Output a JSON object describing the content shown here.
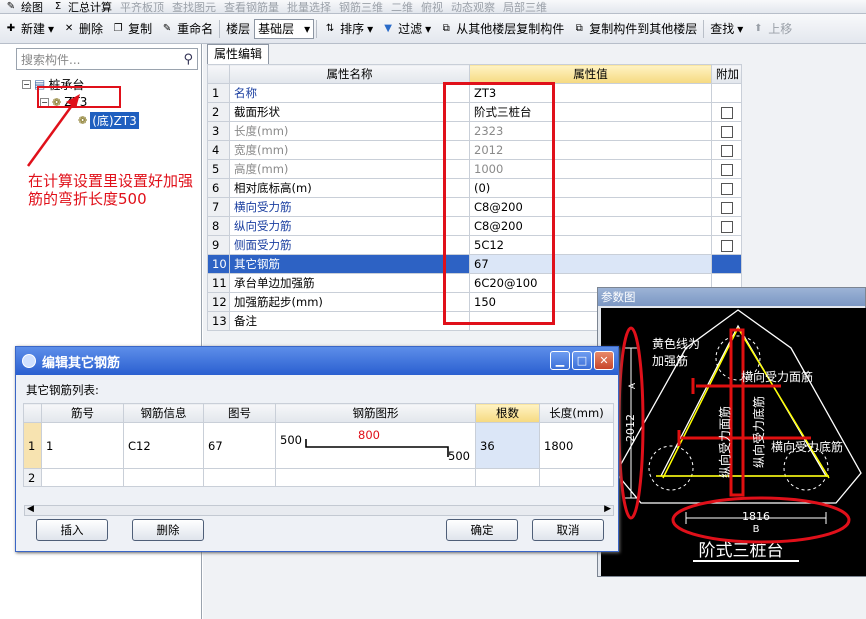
{
  "toolbar1": {
    "items": [
      "绘图",
      "汇总计算",
      "平齐板顶",
      "查找图元",
      "查看钢筋量",
      "批量选择",
      "钢筋三维",
      "二维",
      "俯视",
      "动态观察",
      "局部三维"
    ]
  },
  "toolbar2": {
    "new": "新建",
    "delete": "删除",
    "copy": "复制",
    "rename": "重命名",
    "floor_label": "楼层",
    "floor_value": "基础层",
    "sort": "排序",
    "filter": "过滤",
    "copy_from": "从其他楼层复制构件",
    "copy_to": "复制构件到其他楼层",
    "find": "查找",
    "up": "上移"
  },
  "left": {
    "search_placeholder": "搜索构件...",
    "tree": {
      "root": "桩承台",
      "child": "ZT3",
      "leaf": "(底)ZT3"
    },
    "annotation": "在计算设置里设置好加强筋的弯折长度500"
  },
  "props": {
    "tab": "属性编辑",
    "headers": [
      "属性名称",
      "属性值",
      "附加"
    ],
    "rows": [
      {
        "n": "1",
        "name": "名称",
        "value": "ZT3",
        "style": "blue",
        "cb": false
      },
      {
        "n": "2",
        "name": "截面形状",
        "value": "阶式三桩台",
        "style": "",
        "cb": true
      },
      {
        "n": "3",
        "name": "长度(mm)",
        "value": "2323",
        "style": "gray",
        "cb": true
      },
      {
        "n": "4",
        "name": "宽度(mm)",
        "value": "2012",
        "style": "gray",
        "cb": true
      },
      {
        "n": "5",
        "name": "高度(mm)",
        "value": "1000",
        "style": "gray",
        "cb": true
      },
      {
        "n": "6",
        "name": "相对底标高(m)",
        "value": "(0)",
        "style": "",
        "cb": true
      },
      {
        "n": "7",
        "name": "横向受力筋",
        "value": "C8@200",
        "style": "blue",
        "cb": true
      },
      {
        "n": "8",
        "name": "纵向受力筋",
        "value": "C8@200",
        "style": "blue",
        "cb": true
      },
      {
        "n": "9",
        "name": "侧面受力筋",
        "value": "5C12",
        "style": "blue",
        "cb": true
      },
      {
        "n": "10",
        "name": "其它钢筋",
        "value": "67",
        "style": "sel",
        "cb": false
      },
      {
        "n": "11",
        "name": "承台单边加强筋",
        "value": "6C20@100",
        "style": "",
        "cb": false
      },
      {
        "n": "12",
        "name": "加强筋起步(mm)",
        "value": "150",
        "style": "",
        "cb": false
      },
      {
        "n": "13",
        "name": "备注",
        "value": "",
        "style": "",
        "cb": false
      }
    ]
  },
  "dialog": {
    "title": "编辑其它钢筋",
    "list_label": "其它钢筋列表:",
    "headers": [
      "筋号",
      "钢筋信息",
      "图号",
      "钢筋图形",
      "根数",
      "长度(mm)"
    ],
    "rows": [
      {
        "n": "1",
        "no": "1",
        "info": "C12",
        "fig": "67",
        "shape_left": "500",
        "shape_mid": "800",
        "shape_right": "500",
        "count": "36",
        "length": "1800"
      },
      {
        "n": "2",
        "no": "",
        "info": "",
        "fig": "",
        "count": "",
        "length": ""
      }
    ],
    "insert": "插入",
    "delete": "删除",
    "ok": "确定",
    "cancel": "取消"
  },
  "param": {
    "title": "参数图",
    "yellow_note": "黄色线为加强筋",
    "top_label": "横向受力面筋",
    "left_label1": "纵向受力面筋",
    "left_label2": "纵向受力底筋",
    "bottom_label": "横向受力底筋",
    "dim_height": "2012",
    "dim_a": "A",
    "dim_width": "1816",
    "dim_b": "B",
    "caption": "阶式三桩台"
  }
}
